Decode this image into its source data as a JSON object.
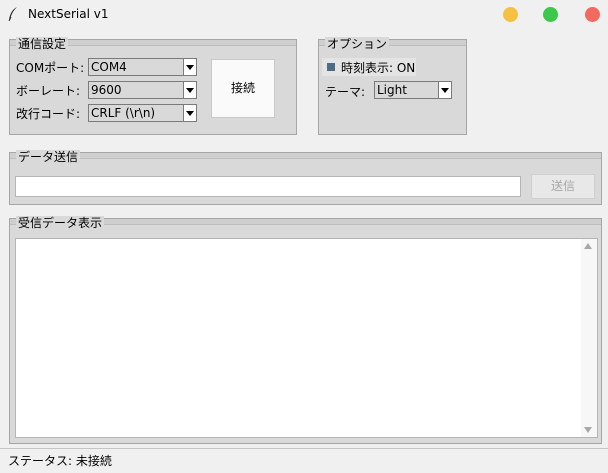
{
  "window": {
    "title": "NextSerial v1"
  },
  "comm": {
    "legend": "通信設定",
    "port_label": "COMポート:",
    "port_value": "COM4",
    "baud_label": "ボーレート:",
    "baud_value": "9600",
    "newline_label": "改行コード:",
    "newline_value": "CRLF (\\r\\n)",
    "connect_label": "接続"
  },
  "options": {
    "legend": "オプション",
    "timestamp_label": "時刻表示: ON",
    "theme_label": "テーマ:",
    "theme_value": "Light"
  },
  "send": {
    "legend": "データ送信",
    "input_value": "",
    "send_label": "送信"
  },
  "receive": {
    "legend": "受信データ表示",
    "content": ""
  },
  "status": {
    "text": "ステータス: 未接続"
  }
}
